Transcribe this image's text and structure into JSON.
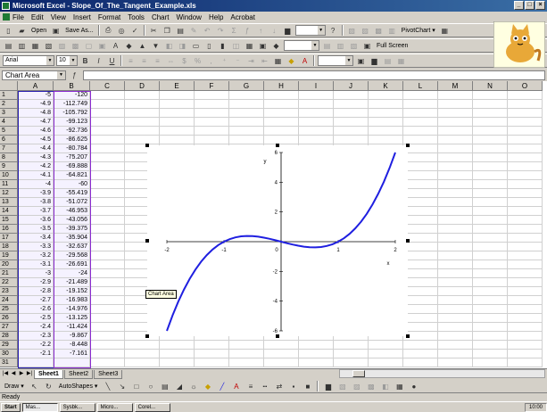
{
  "window": {
    "title": "Microsoft Excel - Slope_Of_The_Tangent_Example.xls",
    "minimize": "_",
    "maximize": "□",
    "close": "×"
  },
  "menu": [
    "File",
    "Edit",
    "View",
    "Insert",
    "Format",
    "Tools",
    "Chart",
    "Window",
    "Help",
    "Acrobat"
  ],
  "toolbar_standard": {
    "open_label": "Open",
    "save_as_label": "Save As...",
    "pivot_chart_label": "PivotChart ▾"
  },
  "toolbar_second": {
    "full_screen_label": "Full Screen"
  },
  "toolbar_format": {
    "font": "Arial",
    "size": "10",
    "bold": "B",
    "italic": "I",
    "underline": "U"
  },
  "name_box": "Chart Area",
  "columns": [
    "A",
    "B",
    "C",
    "D",
    "E",
    "F",
    "G",
    "H",
    "I",
    "J",
    "K",
    "L",
    "M",
    "N",
    "O"
  ],
  "rows": [
    {
      "n": "1",
      "a": "-5",
      "b": "-120"
    },
    {
      "n": "2",
      "a": "-4.9",
      "b": "-112.749"
    },
    {
      "n": "3",
      "a": "-4.8",
      "b": "-105.792"
    },
    {
      "n": "4",
      "a": "-4.7",
      "b": "-99.123"
    },
    {
      "n": "5",
      "a": "-4.6",
      "b": "-92.736"
    },
    {
      "n": "6",
      "a": "-4.5",
      "b": "-86.625"
    },
    {
      "n": "7",
      "a": "-4.4",
      "b": "-80.784"
    },
    {
      "n": "8",
      "a": "-4.3",
      "b": "-75.207"
    },
    {
      "n": "9",
      "a": "-4.2",
      "b": "-69.888"
    },
    {
      "n": "10",
      "a": "-4.1",
      "b": "-64.821"
    },
    {
      "n": "11",
      "a": "-4",
      "b": "-60"
    },
    {
      "n": "12",
      "a": "-3.9",
      "b": "-55.419"
    },
    {
      "n": "13",
      "a": "-3.8",
      "b": "-51.072"
    },
    {
      "n": "14",
      "a": "-3.7",
      "b": "-46.953"
    },
    {
      "n": "15",
      "a": "-3.6",
      "b": "-43.056"
    },
    {
      "n": "16",
      "a": "-3.5",
      "b": "-39.375"
    },
    {
      "n": "17",
      "a": "-3.4",
      "b": "-35.904"
    },
    {
      "n": "18",
      "a": "-3.3",
      "b": "-32.637"
    },
    {
      "n": "19",
      "a": "-3.2",
      "b": "-29.568"
    },
    {
      "n": "20",
      "a": "-3.1",
      "b": "-26.691"
    },
    {
      "n": "21",
      "a": "-3",
      "b": "-24"
    },
    {
      "n": "22",
      "a": "-2.9",
      "b": "-21.489"
    },
    {
      "n": "23",
      "a": "-2.8",
      "b": "-19.152"
    },
    {
      "n": "24",
      "a": "-2.7",
      "b": "-16.983"
    },
    {
      "n": "25",
      "a": "-2.6",
      "b": "-14.976"
    },
    {
      "n": "26",
      "a": "-2.5",
      "b": "-13.125"
    },
    {
      "n": "27",
      "a": "-2.4",
      "b": "-11.424"
    },
    {
      "n": "28",
      "a": "-2.3",
      "b": "-9.867"
    },
    {
      "n": "29",
      "a": "-2.2",
      "b": "-8.448"
    },
    {
      "n": "30",
      "a": "-2.1",
      "b": "-7.161"
    },
    {
      "n": "31",
      "a": "",
      "b": ""
    }
  ],
  "chart_tooltip": "Chart Area",
  "chart_data": {
    "type": "scatter",
    "style": "smooth-line",
    "series_color": "#1f1fe0",
    "xlabel": "x",
    "ylabel": "y",
    "xlim": [
      -2,
      2
    ],
    "ylim": [
      -6,
      6
    ],
    "xticks": [
      -2,
      -1,
      0,
      1,
      2
    ],
    "yticks": [
      -6,
      -4,
      -2,
      0,
      2,
      4,
      6
    ],
    "tick_labels_x": [
      "-2",
      "-1",
      "0",
      "1",
      "2"
    ],
    "tick_labels_y": [
      "-6",
      "-4",
      "-2",
      "",
      "2",
      "4",
      "6"
    ],
    "x": [
      -2.0,
      -1.9,
      -1.8,
      -1.7,
      -1.6,
      -1.5,
      -1.4,
      -1.3,
      -1.2,
      -1.1,
      -1.0,
      -0.9,
      -0.8,
      -0.7,
      -0.6,
      -0.5,
      -0.4,
      -0.3,
      -0.2,
      -0.1,
      0.0,
      0.1,
      0.2,
      0.3,
      0.4,
      0.5,
      0.6,
      0.7,
      0.8,
      0.9,
      1.0,
      1.1,
      1.2,
      1.3,
      1.4,
      1.5,
      1.6,
      1.7,
      1.8,
      1.9,
      2.0
    ],
    "y": [
      -6.0,
      -4.959,
      -4.032,
      -3.213,
      -2.496,
      -1.875,
      -1.344,
      -0.897,
      -0.528,
      -0.231,
      0.0,
      0.171,
      0.288,
      0.357,
      0.384,
      0.375,
      0.336,
      0.273,
      0.192,
      0.099,
      0.0,
      -0.099,
      -0.192,
      -0.273,
      -0.336,
      -0.375,
      -0.384,
      -0.357,
      -0.288,
      -0.171,
      0.0,
      0.231,
      0.528,
      0.897,
      1.344,
      1.875,
      2.496,
      3.213,
      4.032,
      4.959,
      6.0
    ],
    "grid": false,
    "legend": "none"
  },
  "sheet_tabs": [
    "Sheet1",
    "Sheet2",
    "Sheet3"
  ],
  "drawing_bar": {
    "draw_label": "Draw ▾",
    "autoshapes_label": "AutoShapes ▾"
  },
  "status": "Ready",
  "taskbar": {
    "start": "Start",
    "items": [
      "Mas...",
      "Sysbk...",
      "Micro...",
      "Corel..."
    ],
    "tray": "10:00"
  }
}
